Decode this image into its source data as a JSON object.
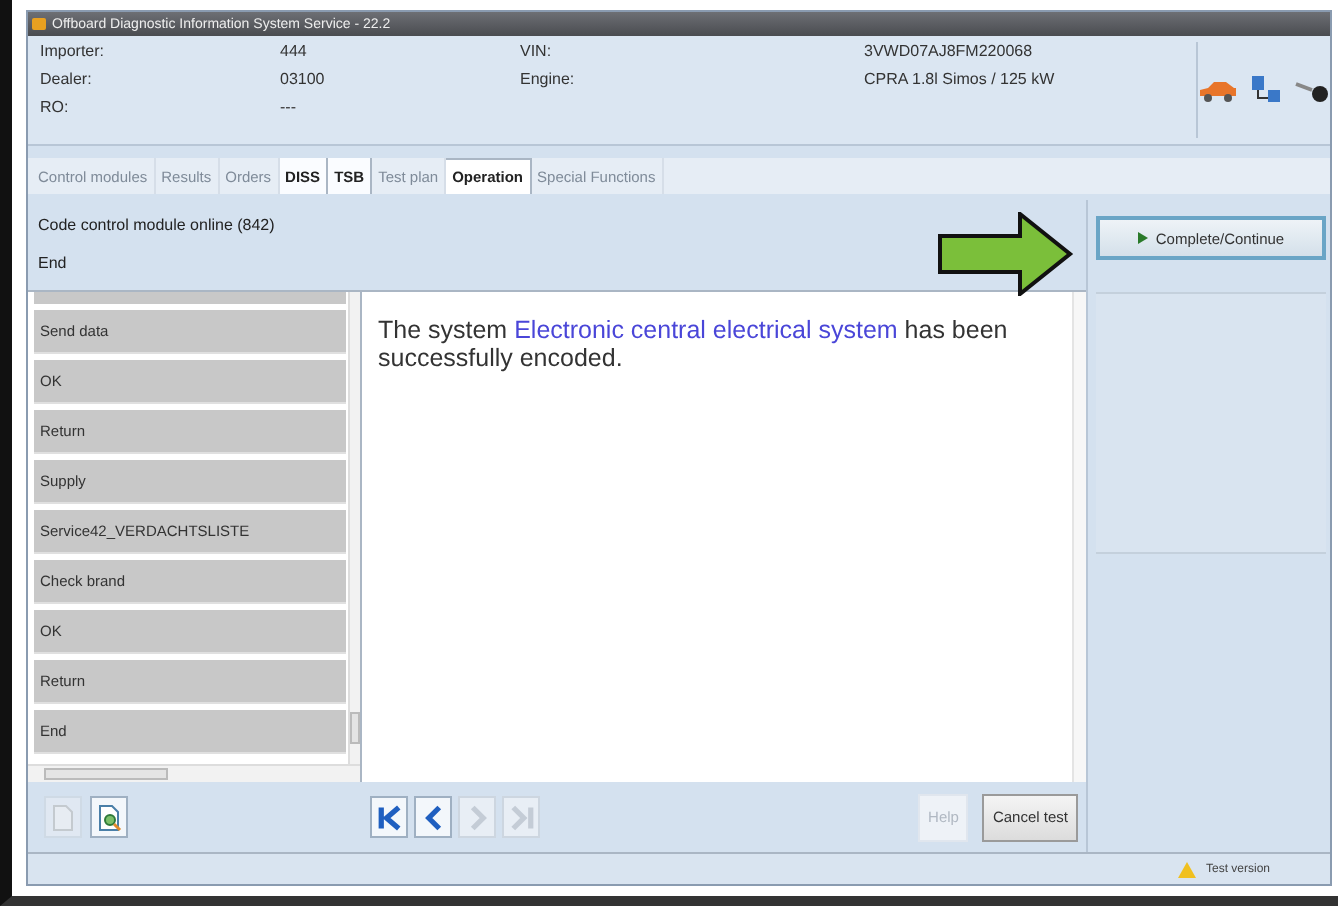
{
  "window": {
    "title": "Offboard Diagnostic Information System Service - 22.2"
  },
  "vehicle_info": [
    {
      "label": "Importer:",
      "value": "444"
    },
    {
      "label": "Dealer:",
      "value": "03100"
    },
    {
      "label": "RO:",
      "value": "---"
    },
    {
      "label": "VIN:",
      "value": "3VWD07AJ8FM220068"
    },
    {
      "label": "Engine:",
      "value": "CPRA 1.8l Simos / 125 kW"
    }
  ],
  "tabs": [
    {
      "label": "Control modules",
      "selected": false,
      "disabled": true
    },
    {
      "label": "Results",
      "selected": false,
      "disabled": true
    },
    {
      "label": "Orders",
      "selected": false,
      "disabled": true
    },
    {
      "label": "DISS",
      "selected": false,
      "disabled": false
    },
    {
      "label": "TSB",
      "selected": false,
      "disabled": false
    },
    {
      "label": "Test plan",
      "selected": false,
      "disabled": true
    },
    {
      "label": "Operation",
      "selected": true,
      "disabled": false
    },
    {
      "label": "Special Functions",
      "selected": false,
      "disabled": true
    }
  ],
  "task": {
    "title": "Code control module online (842)",
    "step": "End"
  },
  "primary_button": {
    "label": "Complete/Continue"
  },
  "steps": [
    "Send data",
    "OK",
    "Return",
    "Supply",
    "Service42_VERDACHTSLISTE",
    "Check brand",
    "OK",
    "Return",
    "End"
  ],
  "message": {
    "before": "The system ",
    "highlight": "Electronic central electrical system",
    "after": " has been successfully encoded."
  },
  "nav_buttons": [
    {
      "kind": "first",
      "disabled": false
    },
    {
      "kind": "prev",
      "disabled": false
    },
    {
      "kind": "next",
      "disabled": true
    },
    {
      "kind": "last",
      "disabled": true
    }
  ],
  "doc_buttons": [
    {
      "kind": "document",
      "disabled": true
    },
    {
      "kind": "preview",
      "disabled": false
    }
  ],
  "buttons": [
    {
      "label": "Help",
      "disabled": true
    },
    {
      "label": "Cancel test",
      "disabled": false
    }
  ],
  "status_bar": {
    "text": "Test version"
  }
}
